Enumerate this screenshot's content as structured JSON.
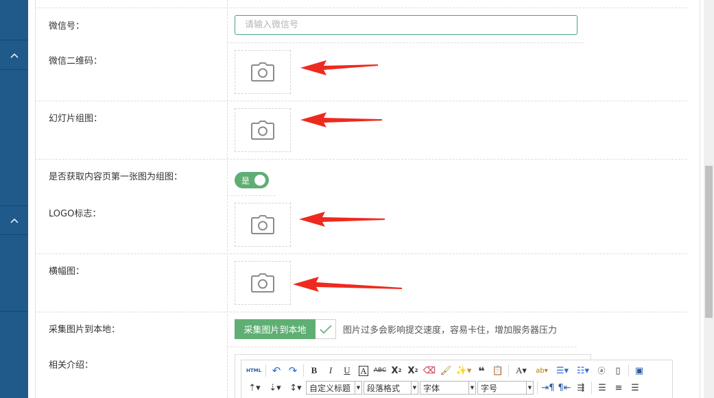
{
  "form": {
    "wechat": {
      "label": "微信号：",
      "placeholder": "请输入微信号",
      "value": ""
    },
    "qrcode": {
      "label": "微信二维码："
    },
    "slides": {
      "label": "幻灯片组图："
    },
    "auto_first_image": {
      "label": "是否获取内容页第一张图为组图：",
      "toggle_text": "是"
    },
    "logo": {
      "label": "LOGO标志："
    },
    "banner": {
      "label": "横幅图："
    },
    "collect": {
      "label": "采集图片到本地：",
      "button_label": "采集图片到本地",
      "tip": "图片过多会影响提交速度，容易卡住，增加服务器压力"
    },
    "intro": {
      "label": "相关介绍："
    }
  },
  "editor": {
    "html_label": "HTML",
    "heading_select": "自定义标题",
    "paragraph_select": "段落格式",
    "font_select": "字体",
    "size_select": "字号"
  },
  "colors": {
    "sidebar": "#1f5a8a",
    "accent_green": "#5fae73",
    "input_border": "#45a089",
    "arrow_red": "#ee2a1f"
  }
}
